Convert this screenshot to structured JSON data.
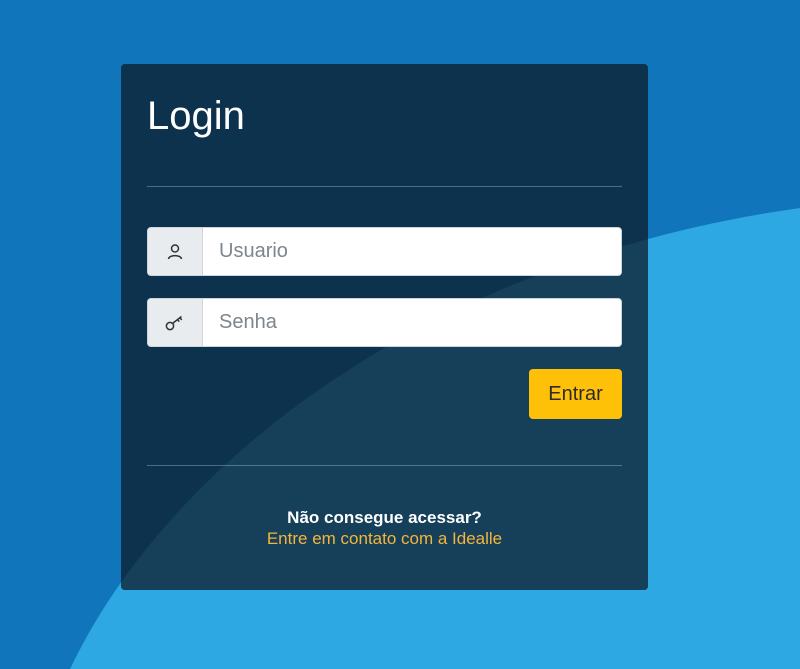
{
  "login": {
    "title": "Login",
    "username": {
      "placeholder": "Usuario",
      "value": "",
      "icon": "user-icon"
    },
    "password": {
      "placeholder": "Senha",
      "value": "",
      "icon": "key-icon"
    },
    "submit_label": "Entrar",
    "help_question": "Não consegue acessar?",
    "help_link": "Entre em contato com a Idealle"
  },
  "colors": {
    "background_dark": "#1075bb",
    "background_light": "#2ea8e3",
    "card_dark": "#0c324e",
    "card_light": "#163f5a",
    "button": "#ffc107",
    "link": "#f4b63a"
  }
}
